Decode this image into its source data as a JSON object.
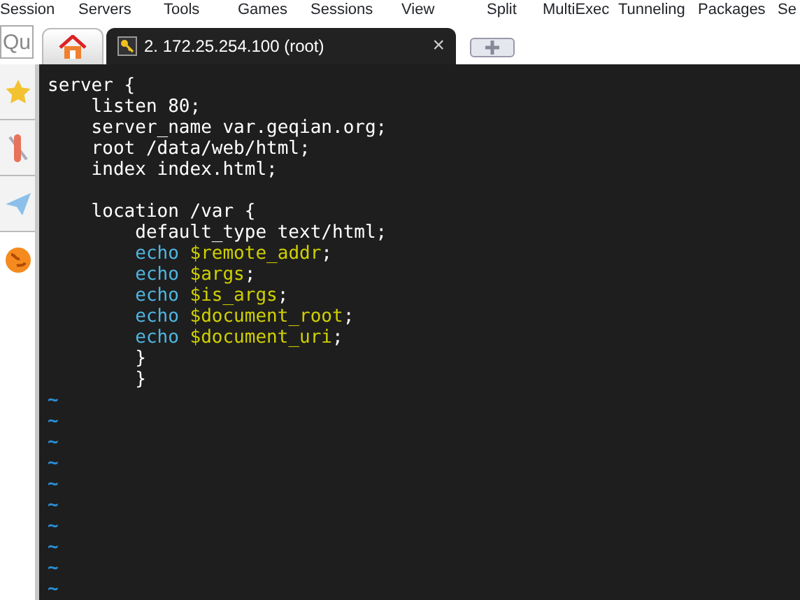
{
  "menu": [
    "Session",
    "Servers",
    "Tools",
    "Games",
    "Sessions",
    "View",
    "Split",
    "MultiExec",
    "Tunneling",
    "Packages",
    "Se"
  ],
  "quick_connect": {
    "placeholder": "Qu"
  },
  "tabs": [
    {
      "kind": "home",
      "selected": false
    },
    {
      "kind": "session",
      "label": "2. 172.25.254.100 (root)",
      "close": "×",
      "selected": true
    }
  ],
  "terminal": {
    "lines": [
      {
        "kind": "code",
        "tokens": [
          {
            "kind": "plain",
            "text": "server {"
          }
        ]
      },
      {
        "kind": "code",
        "tokens": [
          {
            "kind": "plain",
            "text": "    listen 80;"
          }
        ]
      },
      {
        "kind": "code",
        "tokens": [
          {
            "kind": "plain",
            "text": "    server_name var.geqian.org;"
          }
        ]
      },
      {
        "kind": "code",
        "tokens": [
          {
            "kind": "plain",
            "text": "    root /data/web/html;"
          }
        ]
      },
      {
        "kind": "code",
        "tokens": [
          {
            "kind": "plain",
            "text": "    index index.html;"
          }
        ]
      },
      {
        "kind": "blank"
      },
      {
        "kind": "code",
        "tokens": [
          {
            "kind": "plain",
            "text": "    location /var {"
          }
        ]
      },
      {
        "kind": "code",
        "tokens": [
          {
            "kind": "plain",
            "text": "        default_type text/html;"
          }
        ]
      },
      {
        "kind": "code",
        "tokens": [
          {
            "kind": "keyword",
            "text": "        echo"
          },
          {
            "kind": "variable",
            "text": " $remote_addr"
          },
          {
            "kind": "plain",
            "text": ";"
          }
        ]
      },
      {
        "kind": "code",
        "tokens": [
          {
            "kind": "keyword",
            "text": "        echo"
          },
          {
            "kind": "variable",
            "text": " $args"
          },
          {
            "kind": "plain",
            "text": ";"
          }
        ]
      },
      {
        "kind": "code",
        "tokens": [
          {
            "kind": "keyword",
            "text": "        echo"
          },
          {
            "kind": "variable",
            "text": " $is_args"
          },
          {
            "kind": "plain",
            "text": ";"
          }
        ]
      },
      {
        "kind": "code",
        "tokens": [
          {
            "kind": "keyword",
            "text": "        echo"
          },
          {
            "kind": "variable",
            "text": " $document_root"
          },
          {
            "kind": "plain",
            "text": ";"
          }
        ]
      },
      {
        "kind": "code",
        "tokens": [
          {
            "kind": "keyword",
            "text": "        echo"
          },
          {
            "kind": "variable",
            "text": " $document_uri"
          },
          {
            "kind": "plain",
            "text": ";"
          }
        ]
      },
      {
        "kind": "code",
        "tokens": [
          {
            "kind": "plain",
            "text": "        }"
          }
        ]
      },
      {
        "kind": "code",
        "tokens": [
          {
            "kind": "plain",
            "text": "        }"
          }
        ]
      },
      {
        "kind": "tilde",
        "text": "~"
      },
      {
        "kind": "tilde",
        "text": "~"
      },
      {
        "kind": "tilde",
        "text": "~"
      },
      {
        "kind": "tilde",
        "text": "~"
      },
      {
        "kind": "tilde",
        "text": "~"
      },
      {
        "kind": "tilde",
        "text": "~"
      },
      {
        "kind": "tilde",
        "text": "~"
      },
      {
        "kind": "tilde",
        "text": "~"
      },
      {
        "kind": "tilde",
        "text": "~"
      },
      {
        "kind": "tilde",
        "text": "~"
      }
    ]
  }
}
